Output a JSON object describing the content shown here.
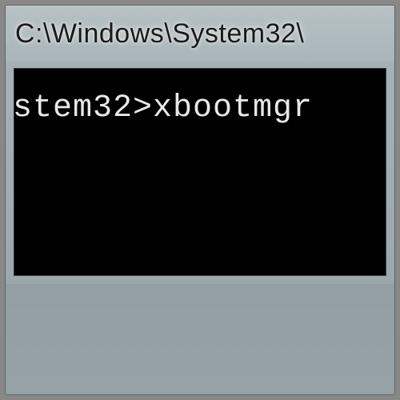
{
  "window": {
    "title_visible": ": C:\\Windows\\System32\\"
  },
  "terminal": {
    "line1": "stem32>xbootmgr "
  }
}
